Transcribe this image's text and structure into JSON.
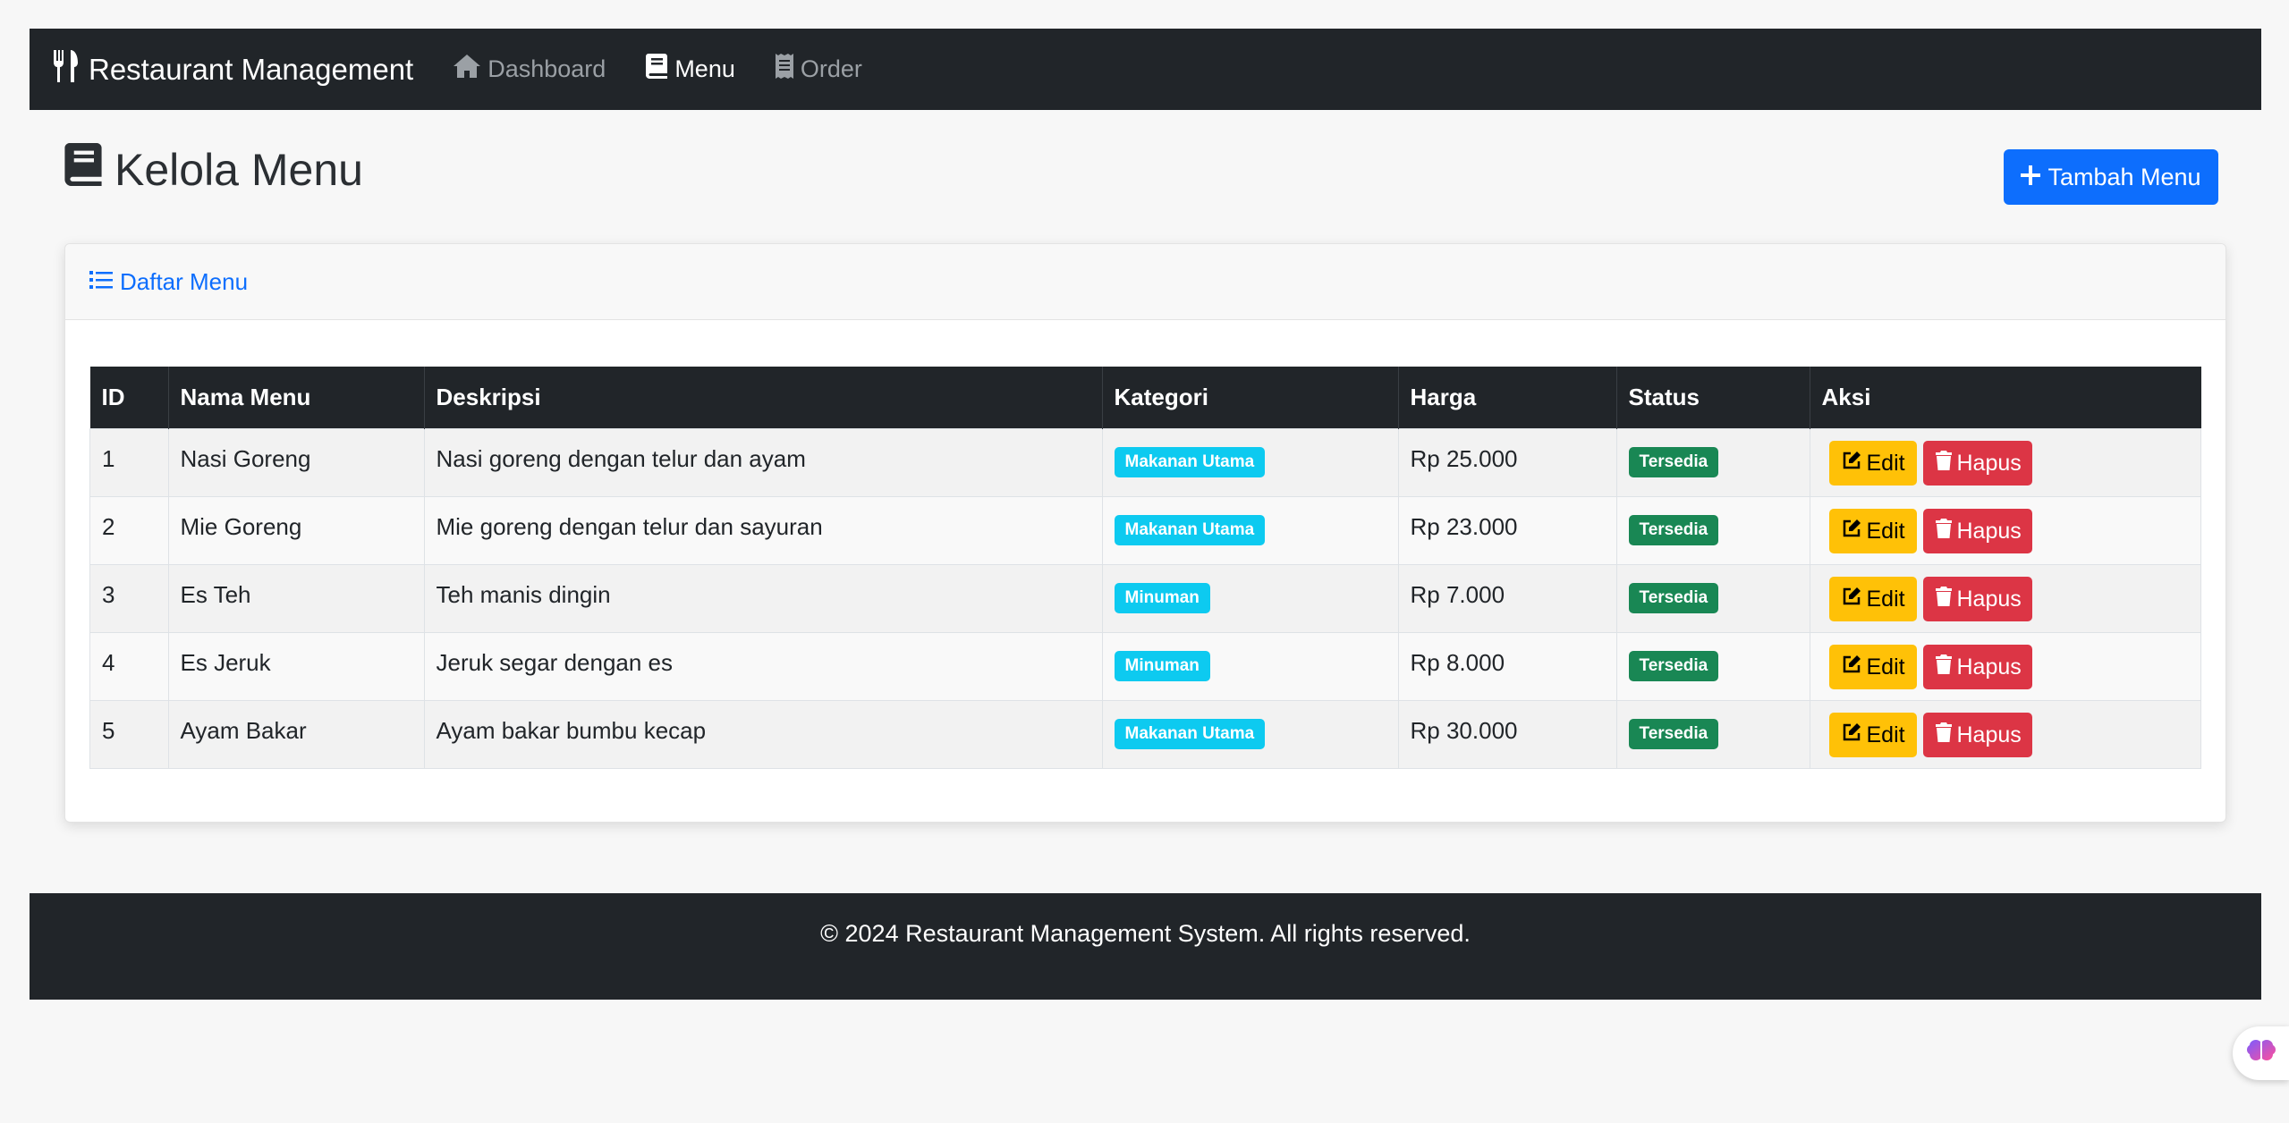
{
  "navbar": {
    "brand": "Restaurant Management",
    "links": [
      {
        "label": "Dashboard",
        "icon": "home-icon",
        "active": false
      },
      {
        "label": "Menu",
        "icon": "book-icon",
        "active": true
      },
      {
        "label": "Order",
        "icon": "receipt-icon",
        "active": false
      }
    ]
  },
  "page": {
    "title": "Kelola Menu",
    "add_button": "Tambah Menu"
  },
  "card": {
    "header": "Daftar Menu"
  },
  "table": {
    "columns": [
      "ID",
      "Nama Menu",
      "Deskripsi",
      "Kategori",
      "Harga",
      "Status",
      "Aksi"
    ],
    "rows": [
      {
        "id": "1",
        "name": "Nasi Goreng",
        "description": "Nasi goreng dengan telur dan ayam",
        "category": "Makanan Utama",
        "price": "Rp 25.000",
        "status": "Tersedia"
      },
      {
        "id": "2",
        "name": "Mie Goreng",
        "description": "Mie goreng dengan telur dan sayuran",
        "category": "Makanan Utama",
        "price": "Rp 23.000",
        "status": "Tersedia"
      },
      {
        "id": "3",
        "name": "Es Teh",
        "description": "Teh manis dingin",
        "category": "Minuman",
        "price": "Rp 7.000",
        "status": "Tersedia"
      },
      {
        "id": "4",
        "name": "Es Jeruk",
        "description": "Jeruk segar dengan es",
        "category": "Minuman",
        "price": "Rp 8.000",
        "status": "Tersedia"
      },
      {
        "id": "5",
        "name": "Ayam Bakar",
        "description": "Ayam bakar bumbu kecap",
        "category": "Makanan Utama",
        "price": "Rp 30.000",
        "status": "Tersedia"
      }
    ],
    "edit_label": "Edit",
    "delete_label": "Hapus"
  },
  "footer": {
    "text": "© 2024 Restaurant Management System. All rights reserved."
  },
  "colors": {
    "primary": "#0d6efd",
    "dark": "#212529",
    "info": "#0dcaf0",
    "success": "#198754",
    "warning": "#ffc107",
    "danger": "#dc3545"
  }
}
